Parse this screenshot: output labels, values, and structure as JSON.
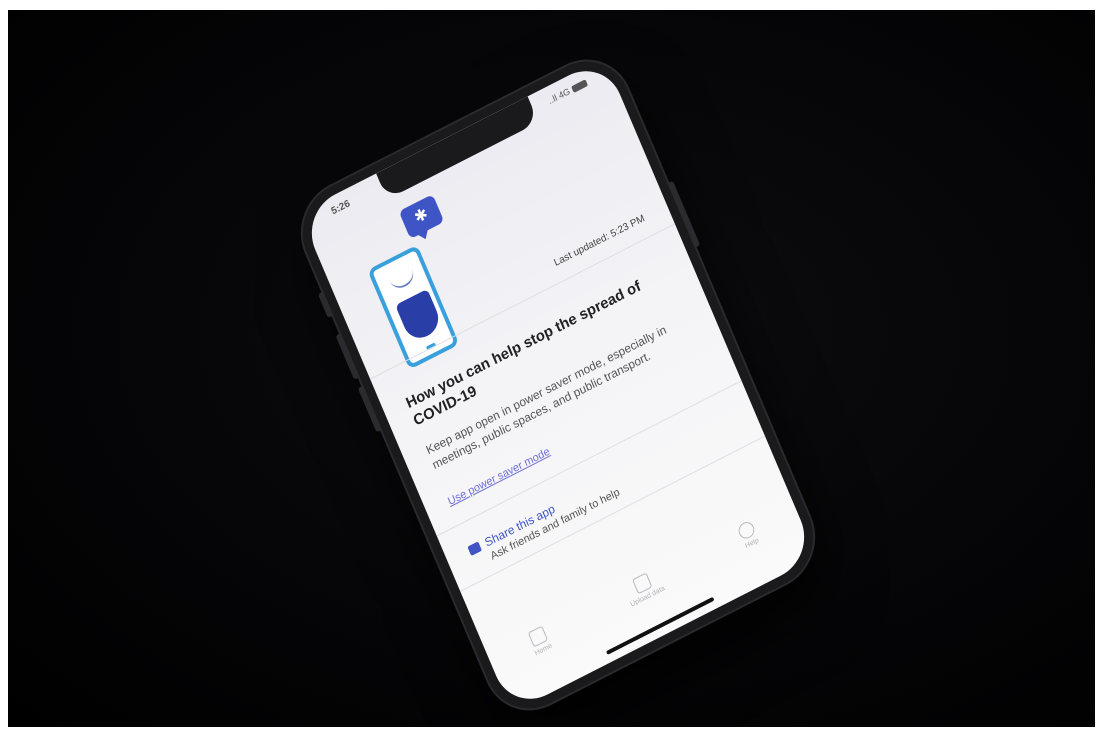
{
  "status_bar": {
    "time": "5:26",
    "signal": "..ll 4G"
  },
  "header": {
    "last_updated": "Last updated: 5:23 PM"
  },
  "main": {
    "headline": "How you can help stop the spread of COVID-19",
    "description": "Keep app open in power saver mode, especially in meetings, public spaces, and public transport.",
    "power_saver_link": "Use power saver mode"
  },
  "share": {
    "title": "Share this app",
    "subtitle": "Ask friends and family to help"
  },
  "tabs": [
    {
      "label": "Home",
      "icon": "home-icon"
    },
    {
      "label": "Upload data",
      "icon": "upload-icon"
    },
    {
      "label": "Help",
      "icon": "help-icon"
    }
  ],
  "colors": {
    "accent": "#3f55c6",
    "illustration_blue": "#3aa0dc",
    "shield": "#2a3ea8",
    "link": "#6f6fd8"
  }
}
